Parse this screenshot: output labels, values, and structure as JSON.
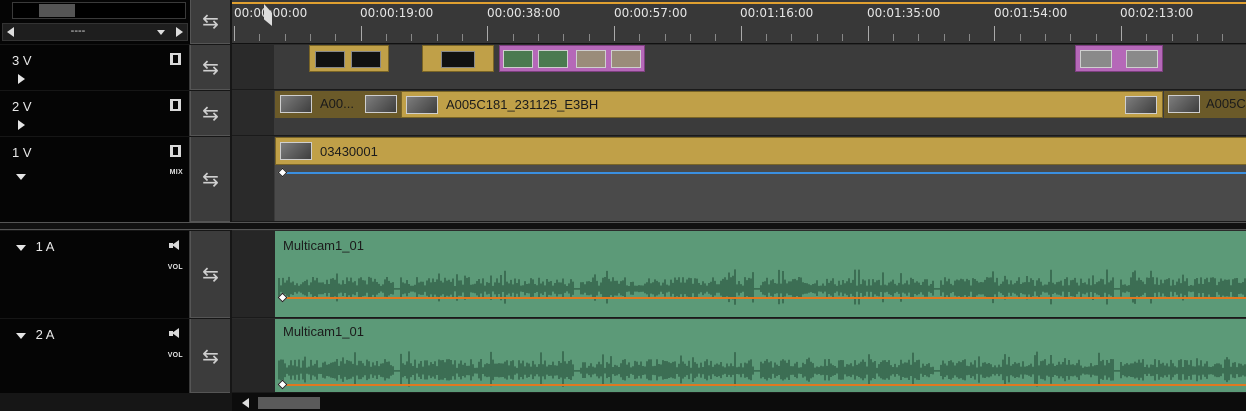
{
  "window": {
    "zoom_value": "----"
  },
  "ruler": {
    "timecodes": [
      "00:00:00:00",
      "00:00:19:00",
      "00:00:38:00",
      "00:00:57:00",
      "00:01:16:00",
      "00:01:35:00",
      "00:01:54:00",
      "00:02:13:00"
    ]
  },
  "tracks": {
    "v3": {
      "name": "3 V"
    },
    "v2": {
      "name": "2 V"
    },
    "v1": {
      "name": "1 V",
      "mix_label": "MIX"
    },
    "a1": {
      "name": "1 A",
      "vol_label": "VOL"
    },
    "a2": {
      "name": "2 A",
      "vol_label": "VOL"
    }
  },
  "clips": {
    "v2_left": "A00...",
    "v2_main": "A005C181_231125_E3BH",
    "v2_right": "A005C",
    "v1_main": "03430001",
    "a1_main": "Multicam1_01",
    "a2_main": "Multicam1_01"
  },
  "icons": {
    "swap": "swap-arrows-icon",
    "film": "film-strip-icon",
    "speaker": "speaker-icon"
  },
  "colors": {
    "clip_gold": "#c0a048",
    "clip_purple": "#b568b8",
    "audio_green": "#5c9a78",
    "rubber_band_blue": "#3a8fe0",
    "volume_line_orange": "#e07820",
    "ruler_in_out": "#e0a030"
  }
}
